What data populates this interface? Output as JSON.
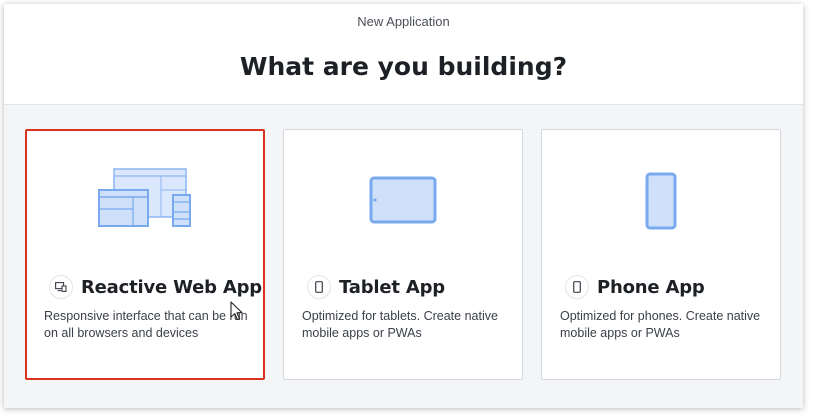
{
  "window": {
    "title": "New Application"
  },
  "heading": "What are you building?",
  "colors": {
    "selected_border": "#d9321f",
    "illustration_fill": "#cfe0fb",
    "illustration_stroke": "#79a9ef"
  },
  "options": [
    {
      "title": "Reactive Web App",
      "description": "Responsive interface that can be run on all browsers and devices",
      "icon": "responsive-devices-icon",
      "selected": true
    },
    {
      "title": "Tablet App",
      "description": "Optimized for tablets. Create native mobile apps or PWAs",
      "icon": "tablet-icon",
      "selected": false
    },
    {
      "title": "Phone App",
      "description": "Optimized for phones. Create native mobile apps or PWAs",
      "icon": "phone-icon",
      "selected": false
    }
  ]
}
